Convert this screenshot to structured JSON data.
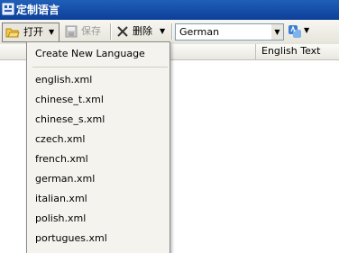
{
  "window": {
    "title": "定制语言"
  },
  "toolbar": {
    "open_label": "打开",
    "save_label": "保存",
    "delete_label": "删除",
    "language_select": {
      "value": "German"
    }
  },
  "grid": {
    "columns": [
      {
        "label": "English Text"
      }
    ]
  },
  "menu": {
    "create_label": "Create New Language",
    "items": [
      {
        "label": "english.xml"
      },
      {
        "label": "chinese_t.xml"
      },
      {
        "label": "chinese_s.xml"
      },
      {
        "label": "czech.xml"
      },
      {
        "label": "french.xml"
      },
      {
        "label": "german.xml"
      },
      {
        "label": "italian.xml"
      },
      {
        "label": "polish.xml"
      },
      {
        "label": "portugues.xml"
      }
    ]
  },
  "icons": {
    "app": "app-icon",
    "open": "open-folder-icon",
    "save": "save-disk-icon",
    "delete": "delete-x-icon",
    "translate": "translate-icon"
  },
  "colors": {
    "titlebar": "#0d3f98",
    "toolbar": "#ece9d8",
    "menu": "#f4f3ee"
  }
}
